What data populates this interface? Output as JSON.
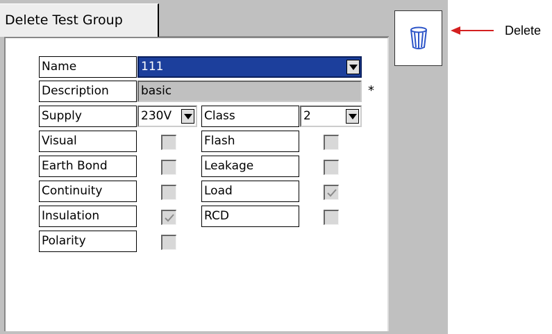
{
  "tab": {
    "title": "Delete Test Group"
  },
  "form": {
    "name_label": "Name",
    "name_value": "111",
    "description_label": "Description",
    "description_value": "basic",
    "required_marker": "*",
    "supply_label": "Supply",
    "supply_value": "230V",
    "class_label": "Class",
    "class_value": "2"
  },
  "tests_left": [
    {
      "label": "Visual",
      "checked": false
    },
    {
      "label": "Earth Bond",
      "checked": false
    },
    {
      "label": "Continuity",
      "checked": false
    },
    {
      "label": "Insulation",
      "checked": true
    },
    {
      "label": "Polarity",
      "checked": false
    }
  ],
  "tests_right": [
    {
      "label": "Flash",
      "checked": false
    },
    {
      "label": "Leakage",
      "checked": false
    },
    {
      "label": "Load",
      "checked": true
    },
    {
      "label": "RCD",
      "checked": false
    }
  ],
  "callout": {
    "label": "Delete",
    "arrow_color": "#d42020"
  },
  "icons": {
    "delete": "trash-icon"
  },
  "colors": {
    "selected_field": "#1c3f9c",
    "disabled_field": "#c0c0c0",
    "screen_bg": "#c0c0c0"
  }
}
